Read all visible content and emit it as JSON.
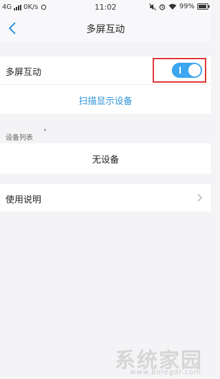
{
  "status_bar": {
    "network": "4G",
    "speed": "0K/s",
    "time": "11:02",
    "battery": "99%"
  },
  "nav": {
    "title": "多屏互动"
  },
  "toggle_row": {
    "label": "多屏互动",
    "enabled": true
  },
  "scan_link": "扫描显示设备",
  "device_list": {
    "header": "设备列表",
    "empty_text": "无设备"
  },
  "help_row": {
    "label": "使用说明"
  },
  "colors": {
    "accent": "#3ea6f0",
    "link": "#2f94d8",
    "highlight_border": "#e03535"
  },
  "watermark": {
    "main": "系统家园",
    "url": "www.bolegdr.com"
  }
}
